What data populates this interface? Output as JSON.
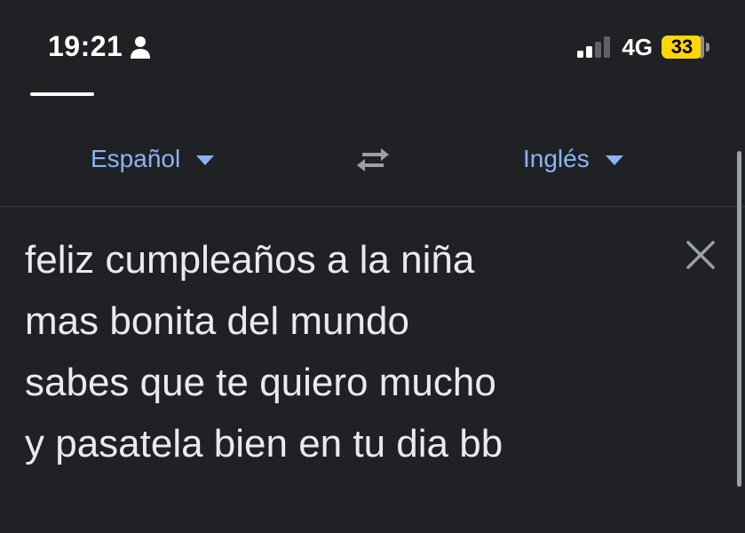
{
  "status_bar": {
    "time": "19:21",
    "network": "4G",
    "battery": "33"
  },
  "language_bar": {
    "source_language": "Español",
    "target_language": "Inglés"
  },
  "input": {
    "text": "feliz cumpleaños a la niña\nmas bonita del mundo\nsabes que te quiero mucho\ny pasatela bien en tu dia bb"
  },
  "colors": {
    "background": "#202124",
    "accent": "#8ab4f8",
    "battery": "#ffd60a"
  },
  "icons": {
    "person": "person-icon",
    "signal": "cellular-signal-icon",
    "swap": "swap-languages-icon",
    "caret": "chevron-down-icon",
    "clear": "close-icon"
  }
}
